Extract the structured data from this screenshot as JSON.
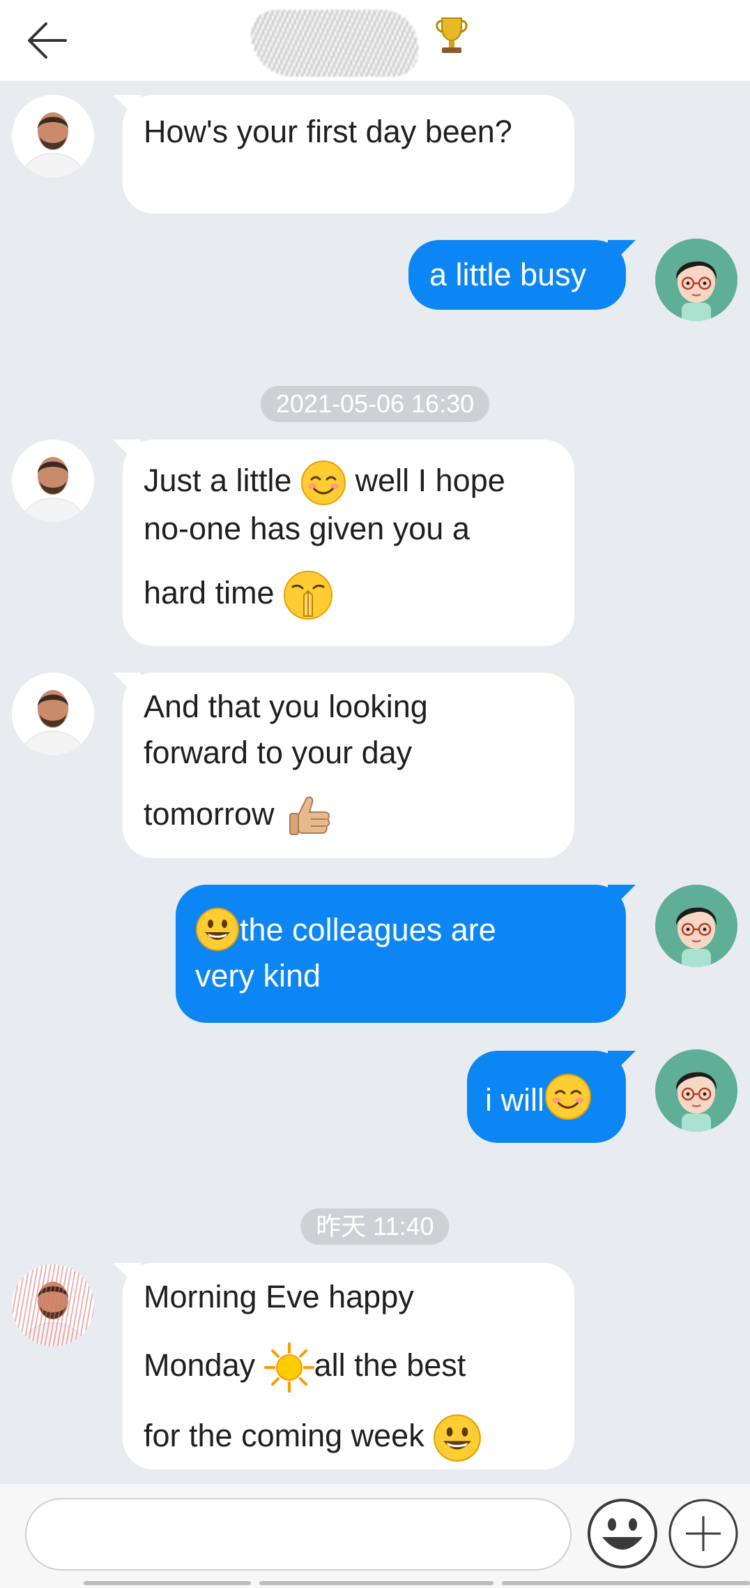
{
  "header": {
    "back_icon": "arrow-left-icon",
    "contact_name": "",
    "badge_icon": "trophy-icon"
  },
  "messages": [
    {
      "side": "in",
      "text": "How's your first day been?"
    },
    {
      "side": "out",
      "text": "a little busy"
    },
    {
      "type": "timestamp",
      "text": "2021-05-06 16:30"
    },
    {
      "side": "in",
      "parts": [
        "Just a little ",
        "smiling-blush-emoji",
        " well I hope no-one has given you a hard time ",
        "hands-together-emoji"
      ]
    },
    {
      "side": "in",
      "parts": [
        "And that you looking forward to your day tomorrow ",
        "thumbs-up-emoji"
      ]
    },
    {
      "side": "out",
      "parts": [
        "grinning-emoji",
        "the colleagues are very kind"
      ]
    },
    {
      "side": "out",
      "parts": [
        "i will",
        "smiling-blush-emoji"
      ]
    },
    {
      "type": "timestamp",
      "text": "昨天 11:40"
    },
    {
      "side": "in",
      "parts": [
        "Morning Eve happy Monday ",
        "sun-emoji",
        "all the best for the coming week ",
        "grinning-emoji"
      ]
    }
  ],
  "m": {
    "m1": "How's your first day been?",
    "m2": "a little busy",
    "ts1": "2021-05-06 16:30",
    "m3a": "Just a little",
    "m3b": "well I hope",
    "m3c": "no-one has given you a",
    "m3d": "hard time",
    "m4a": "And that you looking",
    "m4b": "forward to your day",
    "m4c": "tomorrow",
    "m5a": "the colleagues are",
    "m5b": "very kind",
    "m6": "i will",
    "ts2": "昨天 11:40",
    "m7a": "Morning Eve happy",
    "m7b": "Monday",
    "m7c": "all the best",
    "m7d": "for the coming week"
  },
  "input": {
    "placeholder": "",
    "value": ""
  },
  "icons": {
    "emoji_button": "smiley-face-icon",
    "plus_button": "plus-icon"
  },
  "colors": {
    "outgoing_bubble": "#0c86f5",
    "incoming_bubble": "#ffffff",
    "background": "#e8ebf0",
    "timestamp_pill": "#cdd0d5"
  }
}
